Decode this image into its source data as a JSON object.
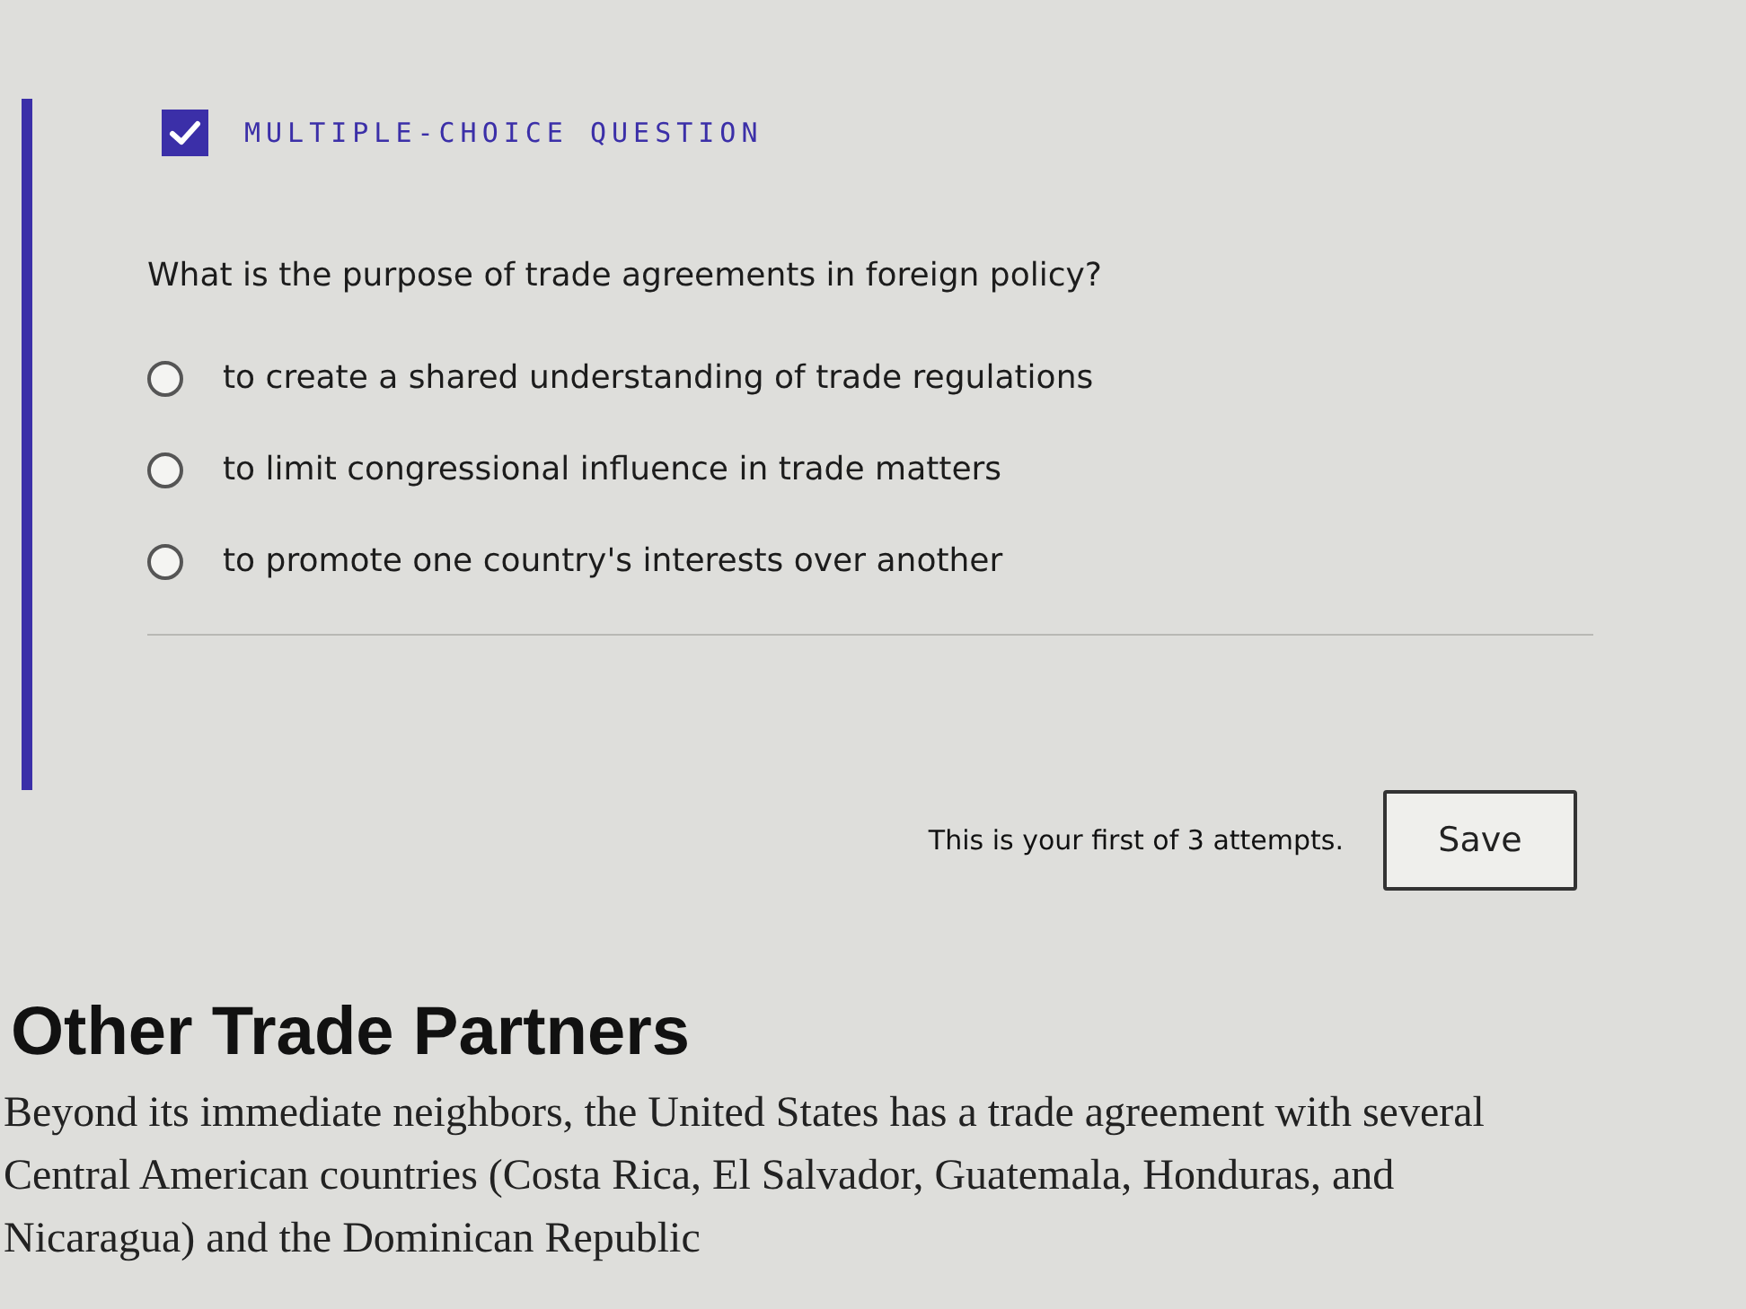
{
  "question": {
    "type_label": "MULTIPLE-CHOICE QUESTION",
    "prompt": "What is the purpose of trade agreements in foreign policy?",
    "options": [
      {
        "label": "to create a shared understanding of trade regulations",
        "selected": false
      },
      {
        "label": "to limit congressional influence in trade matters",
        "selected": false
      },
      {
        "label": "to promote one country's interests over another",
        "selected": false
      }
    ],
    "attempts_note": "This is your first of 3 attempts.",
    "save_button": "Save"
  },
  "article": {
    "heading": "Other Trade Partners",
    "paragraph": "Beyond its immediate neighbors, the United States has a trade agreement with several Central American countries (Costa Rica, El Salvador, Guatemala, Honduras, and Nicaragua) and the Dominican Republic"
  }
}
